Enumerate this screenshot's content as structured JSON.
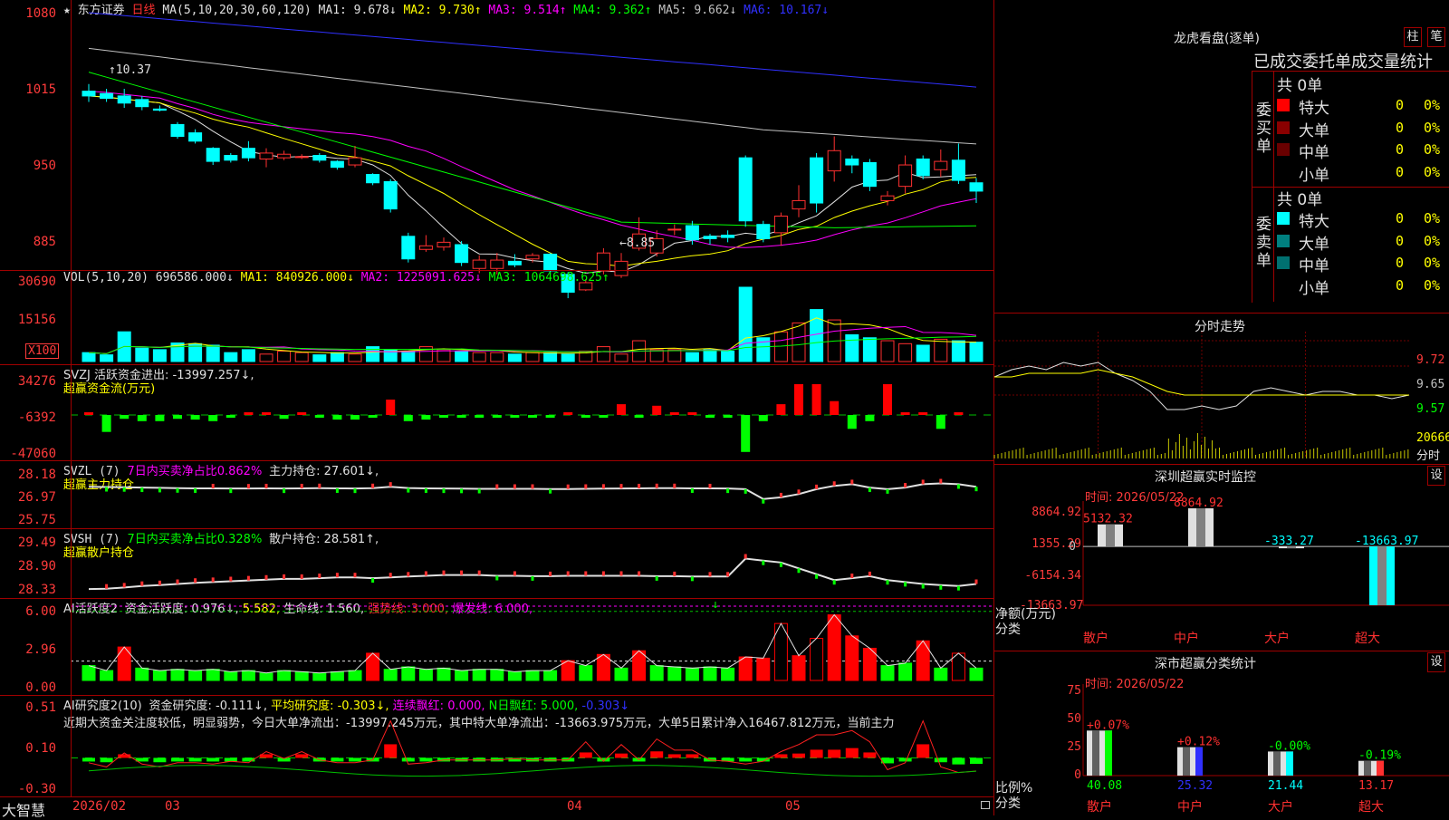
{
  "stock": {
    "name": "东方证券",
    "period": "日线",
    "ma_label": "MA(5,10,20,30,60,120)",
    "ma": [
      {
        "label": "MA1: 9.678↓",
        "color": "#e0e0e0"
      },
      {
        "label": "MA2: 9.730↑",
        "color": "#ffff00"
      },
      {
        "label": "MA3: 9.514↑",
        "color": "#ff00ff"
      },
      {
        "label": "MA4: 9.362↑",
        "color": "#00ff00"
      },
      {
        "label": "MA5: 9.662↓",
        "color": "#c0c0c0"
      },
      {
        "label": "MA6: 10.167↓",
        "color": "#3030ff"
      }
    ],
    "y_ticks": [
      "1080",
      "1015",
      "950",
      "885"
    ],
    "high_note": "10.37",
    "low_note": "8.85"
  },
  "vol_panel": {
    "title": "VOL(5,10,20)",
    "items": [
      {
        "label": "696586.000↓",
        "color": "#e0e0e0"
      },
      {
        "label": "MA1: 840926.000↓",
        "color": "#ffff00"
      },
      {
        "label": "MA2: 1225091.625↓",
        "color": "#ff00ff"
      },
      {
        "label": "MA3: 1064698.625↑",
        "color": "#00ff00"
      }
    ],
    "y_ticks": [
      "30690",
      "15156"
    ],
    "unit": "X100"
  },
  "svzj_panel": {
    "title": "SVZJ  活跃资金进出: -13997.257↓,",
    "subtitle": "超赢资金流(万元)",
    "y_ticks": [
      "34276",
      "-6392",
      "-47060"
    ]
  },
  "svzl_panel": {
    "title": "SVZL (7)",
    "ratio": "7日内买卖净占比0.862%",
    "hold": "主力持仓: 27.601↓,",
    "subtitle": "超赢主力持仓",
    "y_ticks": [
      "28.18",
      "26.97",
      "25.75"
    ]
  },
  "svsh_panel": {
    "title": "SVSH (7)",
    "ratio": "7日内买卖净占比0.328%",
    "hold": "散户持仓: 28.581↑,",
    "subtitle": "超赢散户持仓",
    "y_ticks": [
      "29.49",
      "28.90",
      "28.33"
    ]
  },
  "ai_active_panel": {
    "title": "AI活跃度2",
    "items": [
      {
        "label": "资金活跃度: 0.976↓,",
        "color": "#e0e0e0"
      },
      {
        "label": "5.582,",
        "color": "#ffff00"
      },
      {
        "label": "生命线: 1.560,",
        "color": "#e0e0e0"
      },
      {
        "label": "强势线: 3.000,",
        "color": "#ff3030"
      },
      {
        "label": "爆发线: 6.000,",
        "color": "#ff00ff"
      }
    ],
    "y_ticks": [
      "6.00",
      "2.96",
      "0.00"
    ]
  },
  "ai_research_panel": {
    "title": "AI研究度2(10)",
    "items": [
      {
        "label": "资金研究度: -0.111↓,",
        "color": "#e0e0e0"
      },
      {
        "label": "平均研究度: -0.303↓,",
        "color": "#ffff00"
      },
      {
        "label": "连续飘红: 0.000,",
        "color": "#ff00ff"
      },
      {
        "label": "N日飘红: 5.000,",
        "color": "#00ff00"
      },
      {
        "label": "-0.303↓",
        "color": "#3030ff"
      }
    ],
    "comment": "近期大资金关注度较低，明显弱势，今日大单净流出：-13997.245万元，其中特大单净流出：-13663.975万元，大单5日累计净入16467.812万元，当前主力",
    "y_ticks": [
      "0.51",
      "0.10",
      "-0.30"
    ]
  },
  "x_axis": {
    "app_name": "大智慧",
    "labels": [
      "2026/02",
      "03",
      "04",
      "05"
    ]
  },
  "dragon": {
    "title": "龙虎看盘(逐单)",
    "btn1": "柱",
    "btn2": "笔",
    "header": "已成交委托单成交量统计",
    "buy_label": "委买单",
    "sell_label": "委卖单",
    "buy_total": "共 0单",
    "sell_total": "共 0单",
    "buy_rows": [
      {
        "name": "特大",
        "count": "0",
        "pct": "0%",
        "color": "#ff0000"
      },
      {
        "name": "大单",
        "count": "0",
        "pct": "0%",
        "color": "#8a0000"
      },
      {
        "name": "中单",
        "count": "0",
        "pct": "0%",
        "color": "#6a0000"
      },
      {
        "name": "小单",
        "count": "0",
        "pct": "0%",
        "color": "#000000"
      }
    ],
    "sell_rows": [
      {
        "name": "特大",
        "count": "0",
        "pct": "0%",
        "color": "#00ffff"
      },
      {
        "name": "大单",
        "count": "0",
        "pct": "0%",
        "color": "#008080"
      },
      {
        "name": "中单",
        "count": "0",
        "pct": "0%",
        "color": "#007070"
      },
      {
        "name": "小单",
        "count": "0",
        "pct": "0%",
        "color": "#000000"
      }
    ]
  },
  "intraday": {
    "title": "分时走势",
    "y_ticks": [
      "9.72",
      "9.65",
      "9.57"
    ],
    "vol_tick": "20666",
    "vol_unit": "分时"
  },
  "monitor": {
    "title": "深圳超赢实时监控",
    "settings": "设",
    "time": "时间: 2026/05/22",
    "y_ticks": [
      "8864.92",
      "1355.29",
      "-6154.34",
      "-13663.97"
    ],
    "ylabel": "净额(万元)",
    "xlabel": "分类"
  },
  "classify": {
    "title": "深市超赢分类统计",
    "settings": "设",
    "time": "时间: 2026/05/22",
    "y_ticks": [
      "75",
      "50",
      "25",
      "0"
    ],
    "ylabel": "比例%",
    "xlabel": "分类"
  },
  "chart_data": [
    {
      "type": "bar",
      "title": "深圳超赢实时监控",
      "categories": [
        "散户",
        "中户",
        "大户",
        "超大"
      ],
      "values": [
        5132.32,
        8864.92,
        -333.27,
        -13663.97
      ],
      "ylabel": "净额(万元)",
      "xlabel": "分类",
      "ylim": [
        -13663.97,
        8864.92
      ]
    },
    {
      "type": "bar",
      "title": "深市超赢分类统计",
      "categories": [
        "散户",
        "中户",
        "大户",
        "超大"
      ],
      "values": [
        40.08,
        25.32,
        21.44,
        13.17
      ],
      "changes": [
        "+0.07%",
        "+0.12%",
        "-0.00%",
        "-0.19%"
      ],
      "ylabel": "比例%",
      "xlabel": "分类",
      "ylim": [
        0,
        75
      ]
    },
    {
      "type": "line",
      "title": "分时走势",
      "y_ticks": [
        9.72,
        9.65,
        9.57
      ],
      "x": [
        0,
        10,
        20,
        30,
        40,
        50,
        60,
        70,
        80,
        90,
        100,
        110,
        120,
        130,
        140,
        150,
        160,
        170,
        180,
        190,
        200,
        210,
        220,
        230,
        240
      ],
      "series": [
        {
          "values": [
            9.62,
            9.64,
            9.65,
            9.64,
            9.66,
            9.65,
            9.66,
            9.63,
            9.61,
            9.58,
            9.53,
            9.53,
            9.54,
            9.53,
            9.54,
            9.58,
            9.59,
            9.58,
            9.57,
            9.58,
            9.58,
            9.57,
            9.57,
            9.56,
            9.57
          ]
        },
        {
          "values": [
            9.62,
            9.62,
            9.63,
            9.63,
            9.63,
            9.63,
            9.64,
            9.63,
            9.62,
            9.6,
            9.58,
            9.57,
            9.57,
            9.57,
            9.57,
            9.57,
            9.57,
            9.57,
            9.57,
            9.57,
            9.57,
            9.57,
            9.57,
            9.57,
            9.57
          ]
        }
      ]
    },
    {
      "type": "bar",
      "title": "K线",
      "ylim": [
        8.85,
        10.8
      ],
      "candles": [
        [
          10.14,
          10.1,
          10.2,
          10.05
        ],
        [
          10.12,
          10.08,
          10.16,
          10.05
        ],
        [
          10.1,
          10.04,
          10.16,
          10.0
        ],
        [
          10.07,
          10.01,
          10.1,
          9.98
        ],
        [
          9.99,
          9.98,
          10.02,
          9.97
        ],
        [
          9.86,
          9.76,
          9.88,
          9.74
        ],
        [
          9.79,
          9.72,
          9.82,
          9.7
        ],
        [
          9.66,
          9.55,
          9.67,
          9.52
        ],
        [
          9.6,
          9.56,
          9.62,
          9.54
        ],
        [
          9.66,
          9.58,
          9.72,
          9.55
        ],
        [
          9.57,
          9.62,
          9.66,
          9.5
        ],
        [
          9.58,
          9.61,
          9.64,
          9.56
        ],
        [
          9.59,
          9.59,
          9.61,
          9.57
        ],
        [
          9.6,
          9.56,
          9.62,
          9.54
        ],
        [
          9.55,
          9.5,
          9.56,
          9.48
        ],
        [
          9.52,
          9.58,
          9.68,
          9.5
        ],
        [
          9.44,
          9.37,
          9.45,
          9.35
        ],
        [
          9.38,
          9.15,
          9.4,
          9.12
        ],
        [
          8.92,
          8.73,
          8.95,
          8.7
        ],
        [
          8.81,
          8.84,
          8.93,
          8.79
        ],
        [
          8.83,
          8.87,
          8.91,
          8.8
        ],
        [
          8.85,
          8.7,
          8.88,
          8.67
        ],
        [
          8.65,
          8.72,
          8.76,
          8.61
        ],
        [
          8.65,
          8.72,
          8.78,
          8.6
        ],
        [
          8.71,
          8.68,
          8.77,
          8.66
        ],
        [
          8.73,
          8.76,
          8.78,
          8.7
        ],
        [
          8.77,
          8.63,
          8.78,
          8.6
        ],
        [
          8.6,
          8.45,
          8.62,
          8.4
        ],
        [
          8.47,
          8.53,
          8.56,
          8.46
        ],
        [
          8.63,
          8.78,
          8.82,
          8.6
        ],
        [
          8.59,
          8.71,
          8.78,
          8.57
        ],
        [
          8.82,
          8.94,
          9.08,
          8.8
        ],
        [
          8.78,
          8.9,
          8.97,
          8.75
        ],
        [
          8.98,
          8.98,
          9.02,
          8.93
        ],
        [
          9.01,
          8.89,
          9.05,
          8.85
        ],
        [
          8.92,
          8.9,
          8.94,
          8.85
        ],
        [
          8.93,
          8.91,
          8.97,
          8.87
        ],
        [
          9.58,
          9.05,
          9.6,
          9.0
        ],
        [
          9.02,
          8.9,
          9.05,
          8.87
        ],
        [
          8.95,
          9.09,
          9.12,
          8.84
        ],
        [
          9.15,
          9.22,
          9.35,
          9.08
        ],
        [
          9.58,
          9.2,
          9.62,
          9.12
        ],
        [
          9.47,
          9.64,
          9.76,
          9.38
        ],
        [
          9.57,
          9.52,
          9.6,
          9.45
        ],
        [
          9.54,
          9.34,
          9.57,
          9.3
        ],
        [
          9.22,
          9.26,
          9.3,
          9.18
        ],
        [
          9.34,
          9.52,
          9.6,
          9.28
        ],
        [
          9.57,
          9.43,
          9.6,
          9.4
        ],
        [
          9.48,
          9.55,
          9.65,
          9.42
        ],
        [
          9.56,
          9.39,
          9.7,
          9.36
        ],
        [
          9.37,
          9.3,
          9.41,
          9.2
        ]
      ]
    }
  ]
}
